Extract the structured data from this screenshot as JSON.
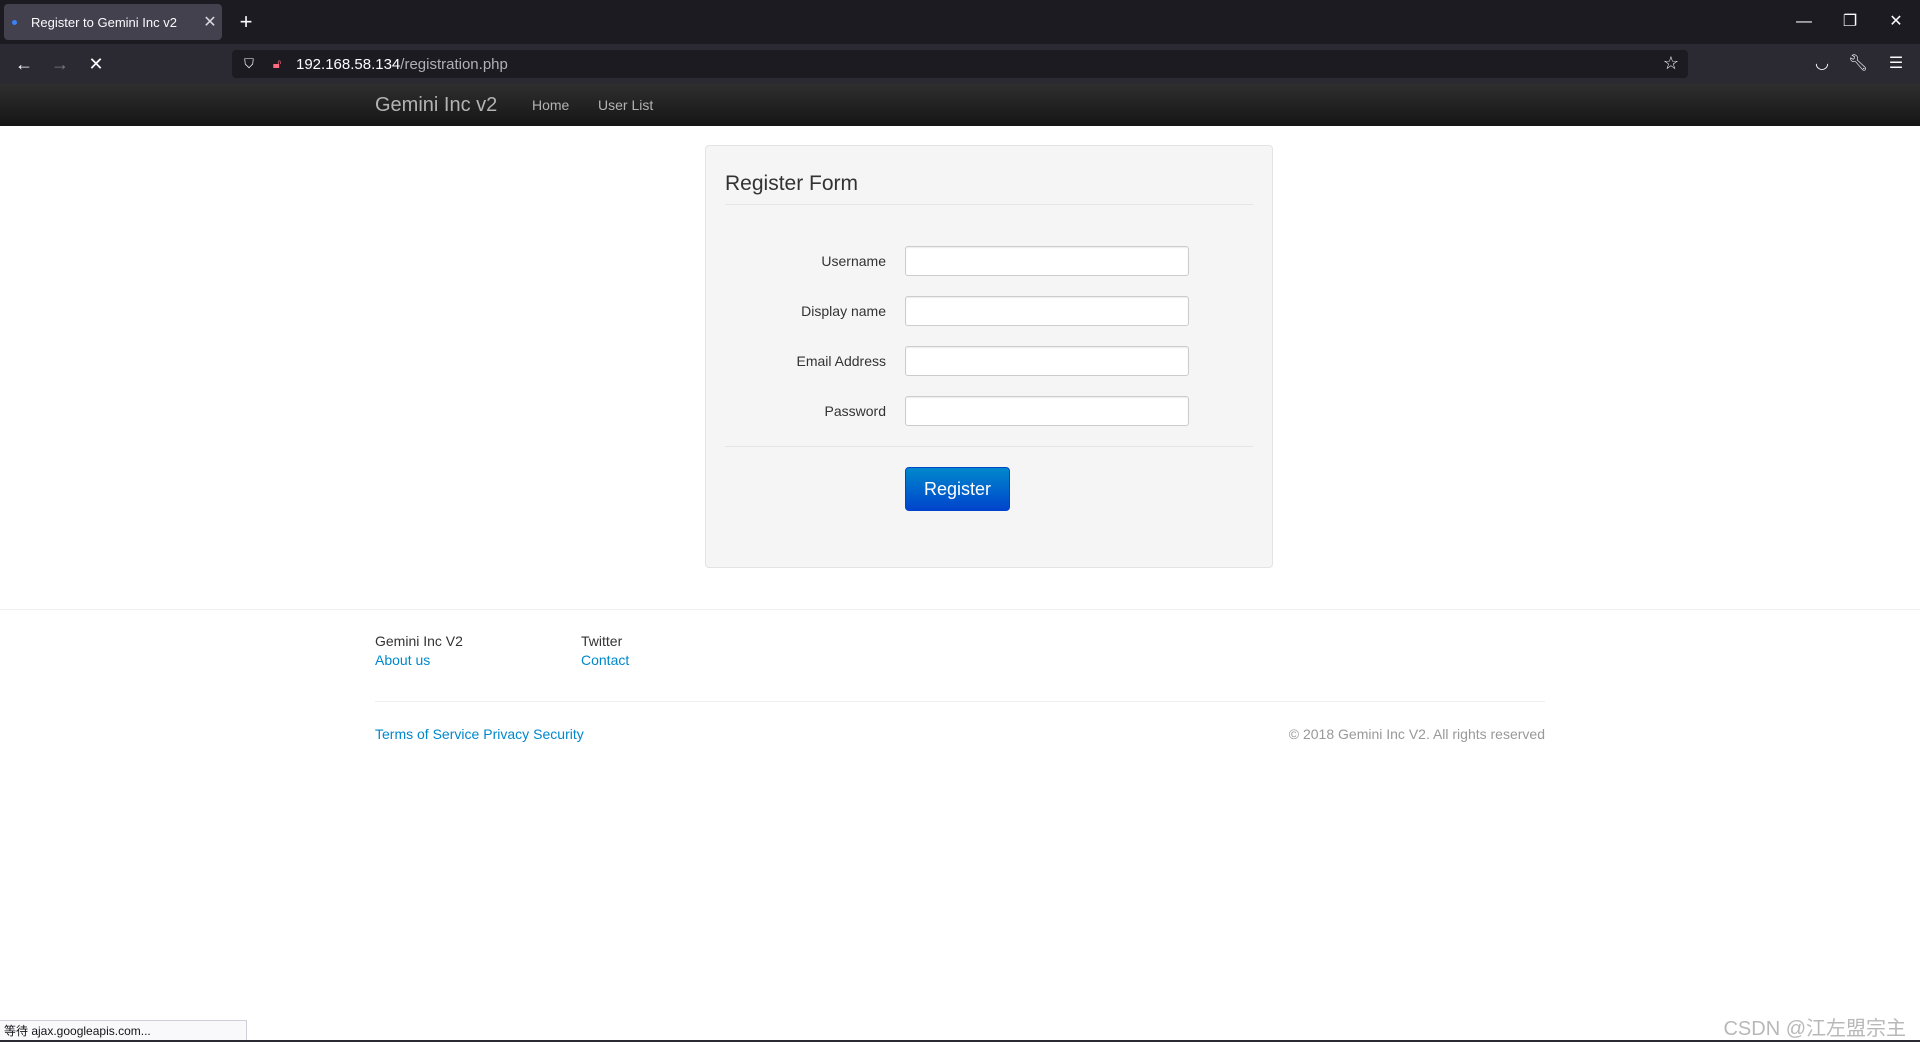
{
  "browser": {
    "tab_title": "Register to Gemini Inc v2",
    "url_host": "192.168.58.134",
    "url_path": "/registration.php",
    "status_text": "等待 ajax.googleapis.com..."
  },
  "site": {
    "brand": "Gemini Inc v2",
    "nav": [
      "Home",
      "User List"
    ]
  },
  "form": {
    "legend": "Register Form",
    "fields": [
      {
        "label": "Username",
        "value": ""
      },
      {
        "label": "Display name",
        "value": ""
      },
      {
        "label": "Email Address",
        "value": ""
      },
      {
        "label": "Password",
        "value": ""
      }
    ],
    "submit_label": "Register"
  },
  "footer": {
    "col1_heading": "Gemini Inc V2",
    "col1_link": "About us",
    "col2_heading": "Twitter",
    "col2_link": "Contact",
    "bottom_links": [
      "Terms of Service",
      "Privacy",
      "Security"
    ],
    "copyright": "© 2018 Gemini Inc V2. All rights reserved"
  },
  "watermark": "CSDN @江左盟宗主",
  "colors": {
    "link": "#0088cc",
    "button": "#0055cc",
    "navbar": "#1b1b1b",
    "browser_chrome": "#1c1b22"
  }
}
